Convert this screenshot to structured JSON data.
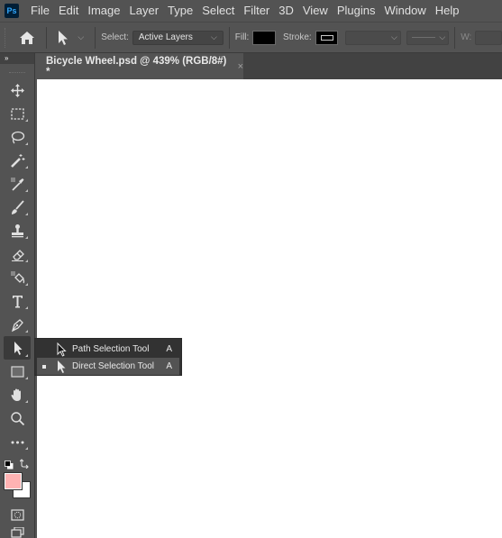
{
  "app": {
    "logo": "Ps"
  },
  "menu": [
    "File",
    "Edit",
    "Image",
    "Layer",
    "Type",
    "Select",
    "Filter",
    "3D",
    "View",
    "Plugins",
    "Window",
    "Help"
  ],
  "options_bar": {
    "select_label": "Select:",
    "select_value": "Active Layers",
    "fill_label": "Fill:",
    "fill_color": "#000000",
    "stroke_label": "Stroke:",
    "width_label": "W:"
  },
  "document_tab": {
    "title": "Bicycle Wheel.psd @ 439% (RGB/8#) *",
    "close": "×"
  },
  "toolbox": {
    "collapse": "»",
    "tools": [
      "move-tool",
      "rectangular-marquee-tool",
      "lasso-tool",
      "magic-wand-tool",
      "eyedropper-tool",
      "brush-tool",
      "clone-stamp-tool",
      "eraser-tool",
      "paint-bucket-tool",
      "type-tool",
      "pen-tool",
      "direct-selection-tool",
      "rectangle-tool",
      "hand-tool",
      "zoom-tool",
      "edit-toolbar"
    ],
    "foreground_color": "#ffb3b3",
    "background_color": "#ffffff"
  },
  "flyout": {
    "items": [
      {
        "label": "Path Selection Tool",
        "shortcut": "A",
        "current": false
      },
      {
        "label": "Direct Selection Tool",
        "shortcut": "A",
        "current": true
      }
    ]
  }
}
